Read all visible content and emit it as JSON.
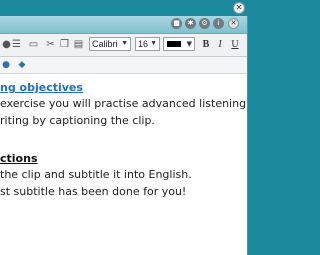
{
  "toolbar": {
    "font_family": "Calibri",
    "font_size": "16",
    "bold_label": "B",
    "italic_label": "I",
    "underline_label": "U",
    "text_color": "#000000"
  },
  "content": {
    "objectives_heading": "ng objectives",
    "objectives_line1": "exercise you will practise advanced listening",
    "objectives_line2": "riting by captioning the clip.",
    "instructions_heading": "ctions",
    "instructions_line1": " the clip and subtitle it into English.",
    "instructions_line2": "st subtitle has been done for you!"
  },
  "icons": {
    "window_close": "close-icon",
    "camera": "camera-icon",
    "settings": "gear-icon",
    "info": "info-icon",
    "panel_close": "close-icon"
  },
  "colors": {
    "window_bg": "#1b8a9c",
    "header_bg": "#8fcad7",
    "link_blue": "#1e6fc6"
  }
}
